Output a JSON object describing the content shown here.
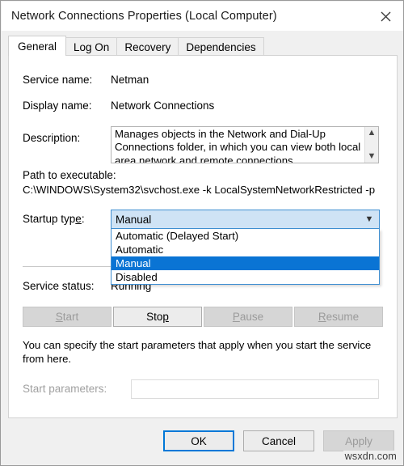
{
  "window": {
    "title": "Network Connections Properties (Local Computer)",
    "close_icon": "close-icon"
  },
  "tabs": [
    {
      "label": "General",
      "active": true
    },
    {
      "label": "Log On",
      "active": false
    },
    {
      "label": "Recovery",
      "active": false
    },
    {
      "label": "Dependencies",
      "active": false
    }
  ],
  "general": {
    "service_name_label": "Service name:",
    "service_name_value": "Netman",
    "display_name_label": "Display name:",
    "display_name_value": "Network Connections",
    "description_label": "Description:",
    "description_value": "Manages objects in the Network and Dial-Up\nConnections folder, in which you can view both local\narea network and remote connections",
    "scroll_up_icon": "chevron-up-icon",
    "scroll_down_icon": "chevron-down-icon",
    "path_label": "Path to executable:",
    "path_value": "C:\\WINDOWS\\System32\\svchost.exe -k LocalSystemNetworkRestricted -p",
    "startup_type_label": "Startup typ",
    "startup_type_accel": "e",
    "startup_type_label_end": ":",
    "startup_type_value": "Manual",
    "startup_dropdown_arrow": "chevron-down-icon",
    "startup_options": [
      {
        "label": "Automatic (Delayed Start)",
        "selected": false
      },
      {
        "label": "Automatic",
        "selected": false
      },
      {
        "label": "Manual",
        "selected": true
      },
      {
        "label": "Disabled",
        "selected": false
      }
    ],
    "service_status_label": "Service status:",
    "service_status_value": "Running",
    "actions": [
      {
        "name": "start",
        "pre": "",
        "accel": "S",
        "post": "tart",
        "enabled": false
      },
      {
        "name": "stop",
        "pre": "Sto",
        "accel": "p",
        "post": "",
        "enabled": true
      },
      {
        "name": "pause",
        "pre": "",
        "accel": "P",
        "post": "ause",
        "enabled": false
      },
      {
        "name": "resume",
        "pre": "",
        "accel": "R",
        "post": "esume",
        "enabled": false
      }
    ],
    "helper_text": "You can specify the start parameters that apply when you start the service from here.",
    "start_parameters_label": "Start parameters:",
    "start_parameters_value": ""
  },
  "footer": {
    "ok_label": "OK",
    "cancel_label": "Cancel",
    "apply_label": "Apply"
  },
  "watermark": "wsxdn.com"
}
